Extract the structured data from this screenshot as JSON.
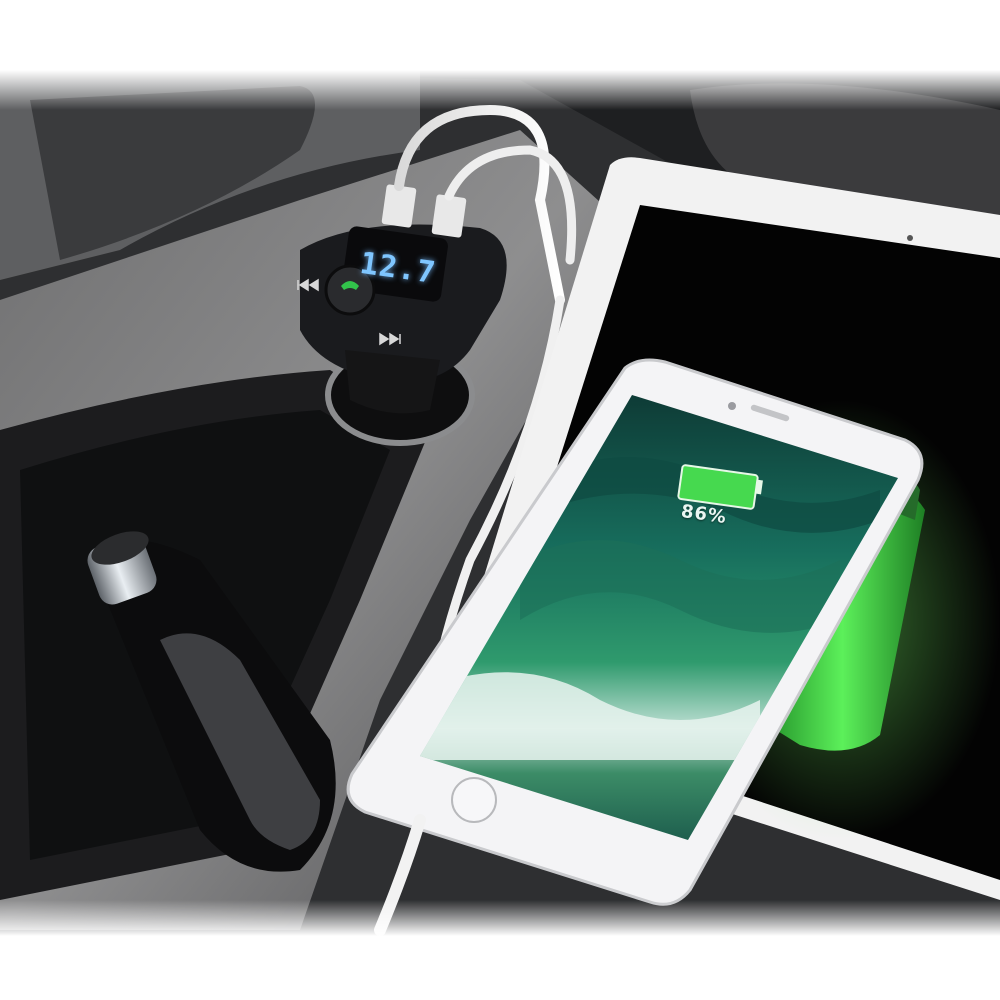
{
  "photo": {
    "subject": "car-charger-product-photo",
    "charger_display_value": "12.7",
    "phone_battery_percent": "86%",
    "phone_battery_level": 0.86,
    "colors": {
      "display_glow": "#7fc6ff",
      "battery_green": "#39d44a",
      "phone_body": "#f4f4f6",
      "tablet_body": "#f2f2f2",
      "charger_body": "#1a1b1e",
      "console_dark": "#2a2b2d"
    },
    "icons": [
      "previous-track-icon",
      "call-answer-icon",
      "next-track-icon",
      "home-button-icon",
      "battery-icon"
    ]
  }
}
